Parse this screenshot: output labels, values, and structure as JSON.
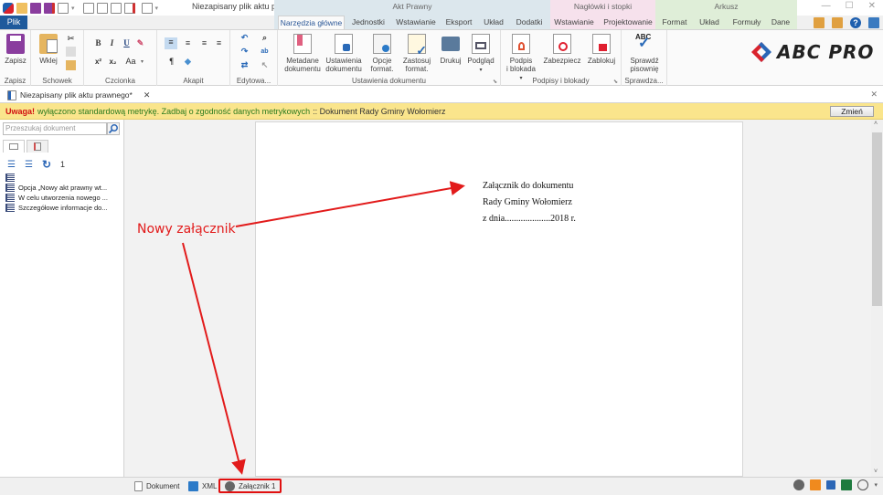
{
  "titlebar": {
    "document_title": "Niezapisany plik aktu praw...",
    "window_controls": [
      "minimize-icon",
      "maximize-icon",
      "close-icon"
    ]
  },
  "context_groups": [
    {
      "label": "Akt Prawny",
      "color": "#dce7ed"
    },
    {
      "label": "Nagłówki i stopki",
      "color": "#f6e1ec"
    },
    {
      "label": "Arkusz",
      "color": "#dfeed8"
    }
  ],
  "tabs": {
    "file": "Plik",
    "items": [
      {
        "label": "Narzędzia główne",
        "active": true
      },
      {
        "label": "Jednostki"
      },
      {
        "label": "Wstawianie"
      },
      {
        "label": "Eksport"
      },
      {
        "label": "Układ"
      },
      {
        "label": "Dodatki"
      },
      {
        "label": "Wstawianie"
      },
      {
        "label": "Projektowanie"
      },
      {
        "label": "Format"
      },
      {
        "label": "Układ"
      },
      {
        "label": "Formuły"
      },
      {
        "label": "Dane"
      }
    ]
  },
  "ribbon": {
    "groups": {
      "zapisz": "Zapisz",
      "schowek": "Schowek",
      "czcionka": "Czcionka",
      "akapit": "Akapit",
      "edytowanie": "Edytowa...",
      "ustawienia": "Ustawienia dokumentu",
      "podpisy": "Podpisy i blokady",
      "sprawdzanie": "Sprawdza..."
    },
    "buttons": {
      "zapisz": "Zapisz",
      "wklej": "Wklej",
      "bold": "B",
      "italic": "I",
      "underline": "U",
      "superscript": "x²",
      "subscript": "x₂",
      "case": "Aa",
      "pilcrow": "¶",
      "metadane_1": "Metadane",
      "metadane_2": "dokumentu",
      "ustawienia_1": "Ustawienia",
      "ustawienia_2": "dokumentu",
      "opcje_1": "Opcje",
      "opcje_2": "format.",
      "zastosuj_1": "Zastosuj",
      "zastosuj_2": "format.",
      "drukuj": "Drukuj",
      "podglad": "Podgląd",
      "podpis_1": "Podpis",
      "podpis_2": "i blokada",
      "zabezpiecz": "Zabezpiecz",
      "zablokuj": "Zablokuj",
      "sprawdz_1": "Sprawdź",
      "sprawdz_2": "pisownię",
      "abc": "ABC"
    }
  },
  "logo": {
    "text": "ABC PRO"
  },
  "document_tab": {
    "label": "Niezapisany plik aktu prawnego*"
  },
  "warning": {
    "bold": "Uwaga!",
    "message": "wyłączono standardową metrykę. Zadbaj o zgodność danych metrykowych",
    "detail": ":: Dokument Rady Gminy  Wołomierz",
    "button": "Zmień"
  },
  "left_panel": {
    "search_placeholder": "Przeszukaj dokument",
    "count": "1",
    "tree": [
      "",
      "Opcja „Nowy akt prawny wt...",
      "W celu utworzenia nowego ...",
      "Szczegółowe informacje do..."
    ]
  },
  "document": {
    "lines": [
      "Załącznik do dokumentu",
      "Rady Gminy  Wołomierz",
      "z dnia....................2018 r."
    ]
  },
  "annotation": {
    "label": "Nowy załącznik",
    "color": "#e21b1b"
  },
  "statusbar": {
    "tabs": [
      {
        "label": "Dokument"
      },
      {
        "label": "XML"
      },
      {
        "label": "Załącznik 1",
        "highlighted": true
      }
    ]
  }
}
